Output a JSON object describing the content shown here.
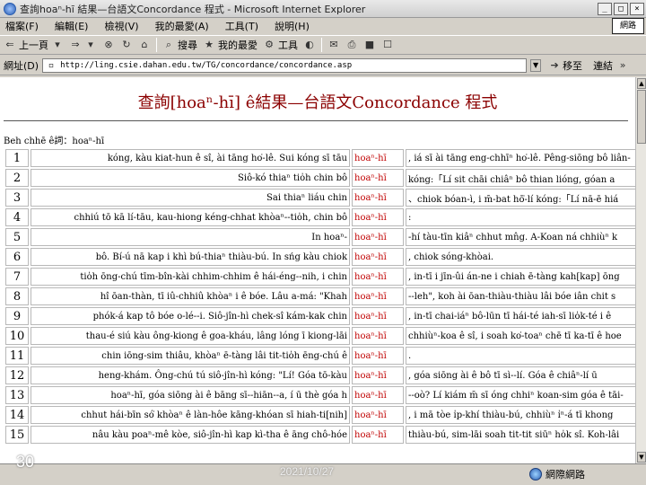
{
  "window": {
    "title": "查詢hoaⁿ-hī 結果—台語文Concordance 程式 - Microsoft Internet Explorer",
    "brand_box": "網路"
  },
  "menu": [
    "檔案(F)",
    "編輯(E)",
    "檢視(V)",
    "我的最愛(A)",
    "工具(T)",
    "說明(H)"
  ],
  "toolbar": {
    "back": "上一頁",
    "search": "搜尋",
    "favorites": "我的最愛",
    "tools": "工具"
  },
  "address": {
    "label": "網址(D)",
    "url": "http://ling.csie.dahan.edu.tw/TG/concordance/concordance.asp",
    "go": "移至",
    "links": "連結"
  },
  "page": {
    "title": "查詢[hoaⁿ-hī] ê結果—台語文Concordance 程式",
    "query": "Beh chhē ê詞：hoaⁿ-hī"
  },
  "rows": [
    {
      "n": "1",
      "left": "kóng, kàu kiat-hun ê sî, ài tāng ho͘-lê. Sui kóng sī tāu",
      "key": "hoaⁿ-hī",
      "right": ", iá sī ài tāng eng-chhīⁿ ho͘-lê. Pêng-siōng bô liân-"
    },
    {
      "n": "2",
      "left": "Siô-kó thiaⁿ tio̍h chin bô",
      "key": "hoaⁿ-hī",
      "right": "kóng:「Lí sit chāi chiâⁿ bô thian lióng, góan a"
    },
    {
      "n": "3",
      "left": "Sai thiaⁿ liáu chin",
      "key": "hoaⁿ-hī",
      "right": "、chiok bóan-ì, i m̄-bat hō͘-lí kóng:「Lí nā-ē hiá"
    },
    {
      "n": "4",
      "left": "chhiú tō kā lí-tāu, kau-hiong kéng-chhat khòaⁿ--tio̍h, chin bô",
      "key": "hoaⁿ-hī",
      "right": ":"
    },
    {
      "n": "5",
      "left": "In hoaⁿ-",
      "key": "hoaⁿ-hī",
      "right": "-hí tàu-tīn kiâⁿ chhut mn̂g. A-Koan ná chhiùⁿ k"
    },
    {
      "n": "6",
      "left": "bô. Bí-ú nā kap i khì bú-thiaⁿ thiàu-bú. In sńg kàu chiok",
      "key": "hoaⁿ-hī",
      "right": ", chiok sóng-khòai."
    },
    {
      "n": "7",
      "left": "tio̍h ōng-chú tīm-bîn-kài chhim-chhim ê hái-éng--nih, i chin",
      "key": "hoaⁿ-hī",
      "right": ", in-tī i jīn-ûi án-ne i chiah ē-tàng kah[kap] ōng"
    },
    {
      "n": "8",
      "left": "hî ōan-thàn, tī iû-chhiû khòaⁿ i ê bóe. Lâu a-má: \"Khah",
      "key": "hoaⁿ-hī",
      "right": "--leh\", koh ài ōan-thiàu-thiàu lâi bóe iân chit s"
    },
    {
      "n": "9",
      "left": "phók-á kap tô bóe o-lé--i. Siô-jîn-hì chek-sî kám-kak chin",
      "key": "hoaⁿ-hī",
      "right": ", in-tī chai-iáⁿ bô-lūn tī hái-té iah-sī lio̍k-té i ê"
    },
    {
      "n": "10",
      "left": "thau-é siú kàu ông-kiong ê goa-kháu, lâng lóng ī kiong-lāi",
      "key": "hoaⁿ-hī",
      "right": "chhiùⁿ-koa ê sî, i soah ko͘-toaⁿ chē tī ka-tī ê hoe"
    },
    {
      "n": "11",
      "left": "chin iōng-sim thiâu, khòaⁿ ē-tàng lâi tit-tio̍h ēng-chú ê",
      "key": "hoaⁿ-hī",
      "right": "."
    },
    {
      "n": "12",
      "left": "heng-khám. Ông-chú tú siô-jîn-hì kóng: \"Lí! Góa tō-kàu",
      "key": "hoaⁿ-hī",
      "right": ", góa siōng ài ê bô tī sì--lí. Góa ê chiâⁿ-lí ū"
    },
    {
      "n": "13",
      "left": "hoaⁿ-hī, góa siōng ài ê bāng sī--hiān--a, í ū thè góa h",
      "key": "hoaⁿ-hī",
      "right": "--oò? Lí kiám m̄ sī óng chhiⁿ koan-sim góa ê tāi-"
    },
    {
      "n": "14",
      "left": "chhut hái-bīn só͘ khòaⁿ ê làn-hôe kāng-khóan sī hiah-ti[nih]",
      "key": "hoaⁿ-hī",
      "right": ", i mā tòe i̍p-khí thiàu-bú, chhiùⁿ i̍ⁿ-á tī khong"
    },
    {
      "n": "15",
      "left": "nâu kàu poaⁿ-mê kòe, siô-jîn-hì kap kì-tha ê āng chô-hóe",
      "key": "hoaⁿ-hī",
      "right": "thiàu-bú, sim-lāi soah tit-tit siūⁿ ho̍k sî. Koh-lâi"
    }
  ],
  "status": {
    "slide_number": "30",
    "date": "2021/10/27",
    "zone": "網際網路"
  }
}
